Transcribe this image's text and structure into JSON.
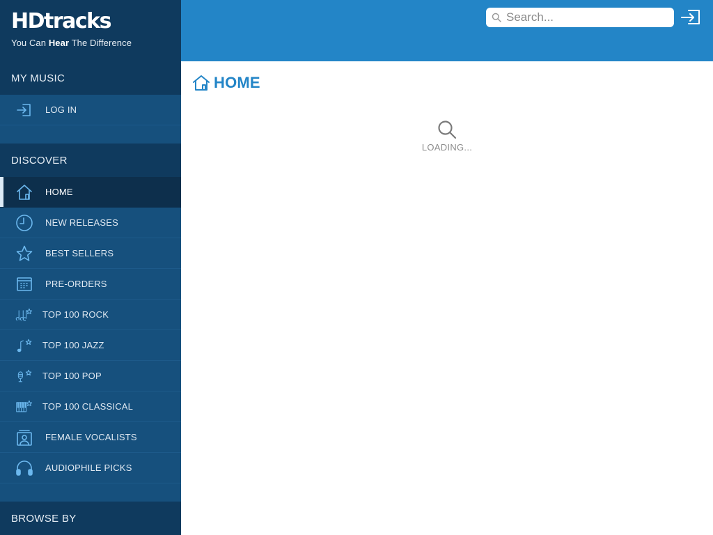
{
  "brand": {
    "logo_text": "HDtracks",
    "tagline_pre": "You Can ",
    "tagline_bold": "Hear",
    "tagline_post": " The Difference"
  },
  "sidebar": {
    "my_music": {
      "heading": "MY MUSIC",
      "items": [
        {
          "label": "LOG IN",
          "icon": "login-icon"
        }
      ]
    },
    "discover": {
      "heading": "DISCOVER",
      "items": [
        {
          "label": "HOME",
          "icon": "home-icon",
          "active": true
        },
        {
          "label": "NEW RELEASES",
          "icon": "clock-icon"
        },
        {
          "label": "BEST SELLERS",
          "icon": "star-icon"
        },
        {
          "label": "PRE-ORDERS",
          "icon": "calendar-icon"
        },
        {
          "label": "TOP 100 ROCK",
          "icon": "guitar-star-icon"
        },
        {
          "label": "TOP 100 JAZZ",
          "icon": "music-note-star-icon"
        },
        {
          "label": "TOP 100 POP",
          "icon": "microphone-star-icon"
        },
        {
          "label": "TOP 100 CLASSICAL",
          "icon": "piano-star-icon"
        },
        {
          "label": "FEMALE VOCALISTS",
          "icon": "female-vocalist-icon"
        },
        {
          "label": "AUDIOPHILE PICKS",
          "icon": "headphones-icon"
        }
      ]
    },
    "browse_by": {
      "heading": "BROWSE BY"
    }
  },
  "topbar": {
    "search": {
      "placeholder": "Search...",
      "value": ""
    },
    "login_icon": "login-icon"
  },
  "main": {
    "title": "HOME",
    "loading_text": "LOADING..."
  },
  "colors": {
    "sidebar_bg": "#16507d",
    "sidebar_head_bg": "#0f3a5e",
    "active_bg": "#0d2f4c",
    "topbar_bg": "#2385c7",
    "accent": "#2385c7",
    "icon": "#6cb8ee"
  }
}
